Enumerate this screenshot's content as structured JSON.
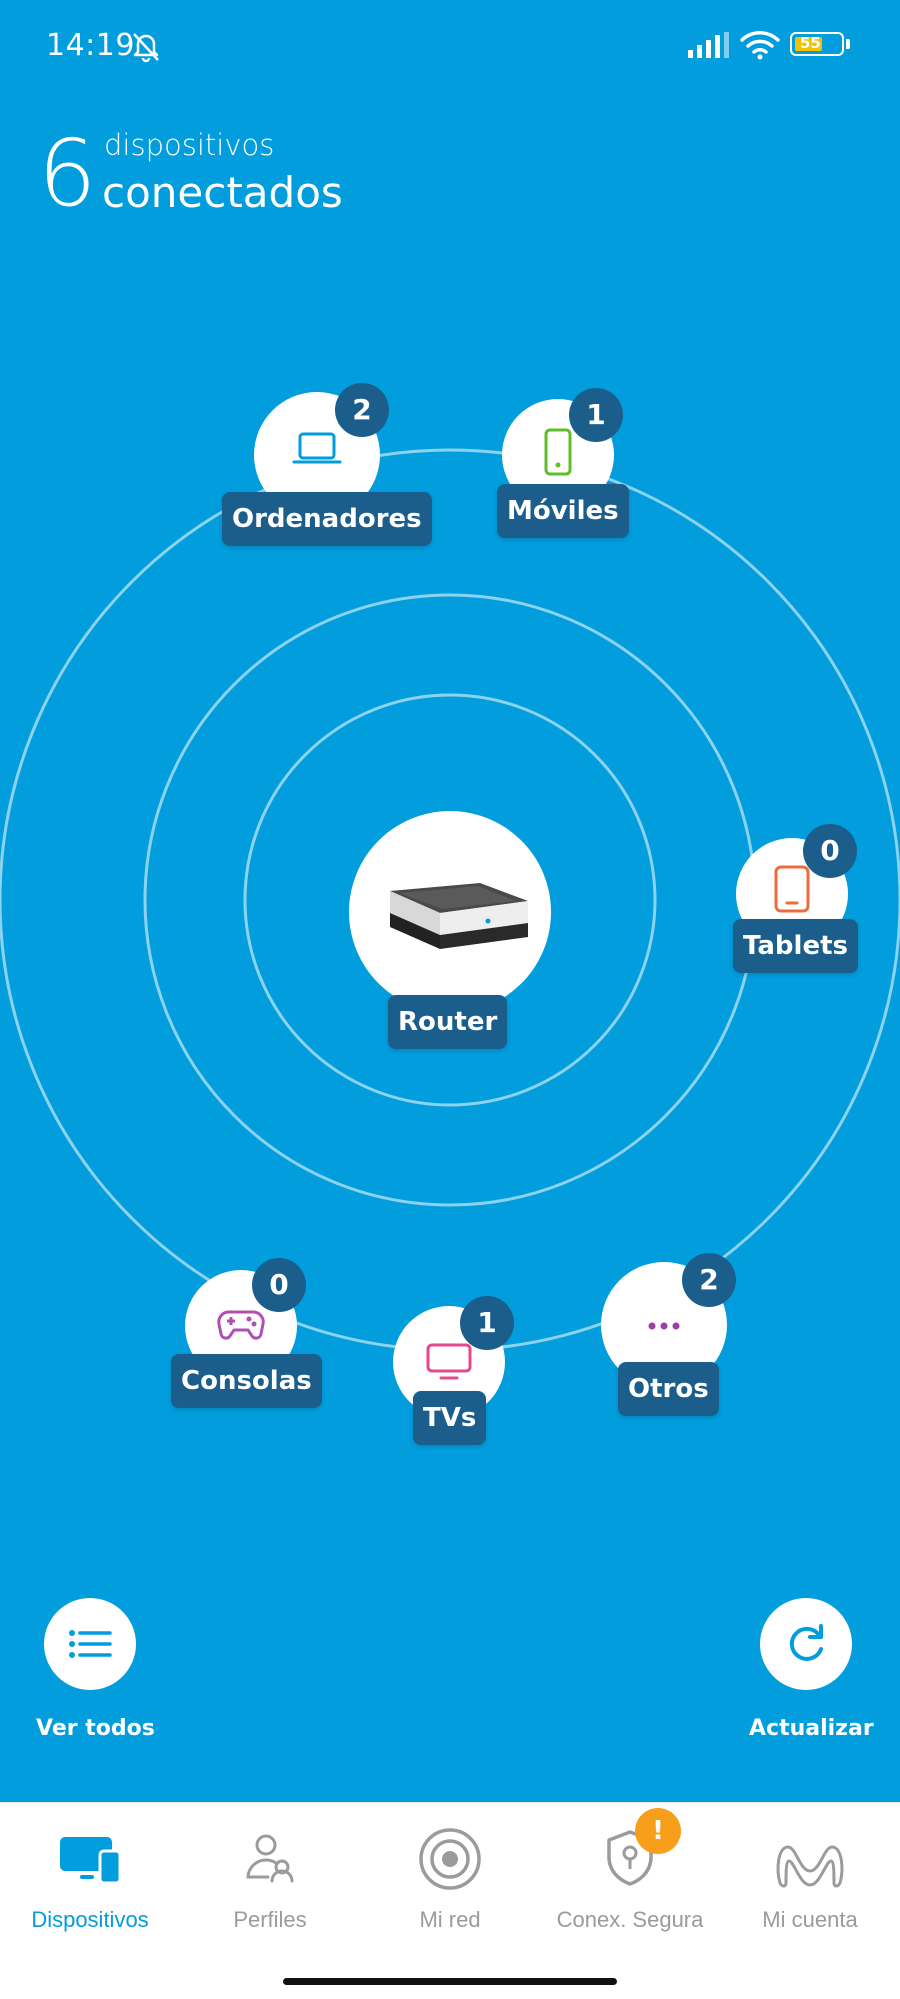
{
  "status_bar": {
    "time": "14:19",
    "battery": "55"
  },
  "header": {
    "count": "6",
    "line1": "dispositivos",
    "line2": "conectados"
  },
  "router": {
    "label": "Router"
  },
  "categories": [
    {
      "label": "Ordenadores",
      "count": "2",
      "icon": "laptop-icon",
      "color": "#019ddd"
    },
    {
      "label": "Móviles",
      "count": "1",
      "icon": "phone-icon",
      "color": "#5cbf2a"
    },
    {
      "label": "Tablets",
      "count": "0",
      "icon": "tablet-icon",
      "color": "#ec6d3a"
    },
    {
      "label": "Consolas",
      "count": "0",
      "icon": "gamepad-icon",
      "color": "#b04fb3"
    },
    {
      "label": "TVs",
      "count": "1",
      "icon": "tv-icon",
      "color": "#e5488b"
    },
    {
      "label": "Otros",
      "count": "2",
      "icon": "more-icon",
      "color": "#9b3fa6"
    }
  ],
  "actions": {
    "view_all": "Ver todos",
    "refresh": "Actualizar"
  },
  "nav": {
    "items": [
      {
        "label": "Dispositivos",
        "active": true
      },
      {
        "label": "Perfiles"
      },
      {
        "label": "Mi red"
      },
      {
        "label": "Conex. Segura",
        "alert": "!"
      },
      {
        "label": "Mi cuenta"
      }
    ]
  },
  "colors": {
    "background": "#019ddd",
    "label": "#1b5e8c",
    "alert": "#f79e1b"
  }
}
